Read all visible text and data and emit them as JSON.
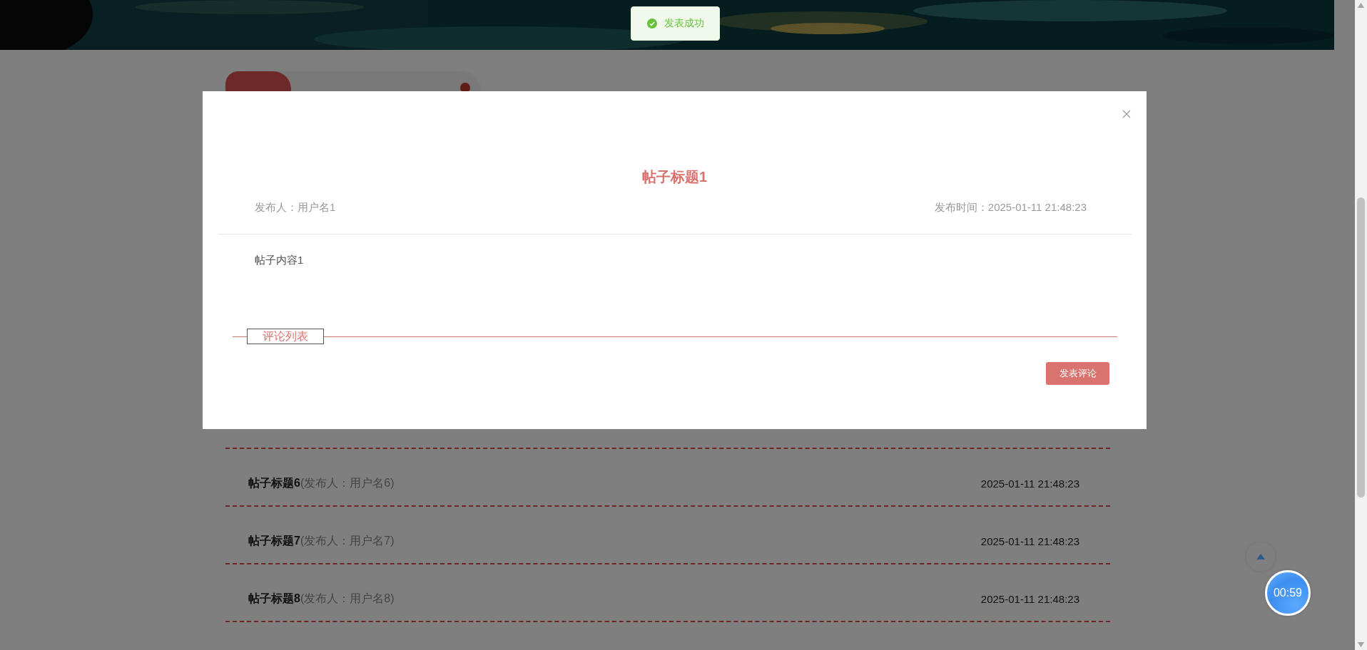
{
  "toast": {
    "kind": "success",
    "text": "发表成功"
  },
  "section": {
    "kind": "pill"
  },
  "posts": [
    {
      "title": "帖子标题6",
      "author": "(发布人：用户名6)",
      "time": "2025-01-11 21:48:23"
    },
    {
      "title": "帖子标题7",
      "author": "(发布人：用户名7)",
      "time": "2025-01-11 21:48:23"
    },
    {
      "title": "帖子标题8",
      "author": "(发布人：用户名8)",
      "time": "2025-01-11 21:48:23"
    }
  ],
  "dialog": {
    "title": "帖子标题1",
    "author": "发布人：用户名1",
    "time": "发布时间：2025-01-11 21:48:23",
    "content": "帖子内容1",
    "comments_heading": "评论列表",
    "button": "发表评论"
  },
  "timer": "00:59"
}
